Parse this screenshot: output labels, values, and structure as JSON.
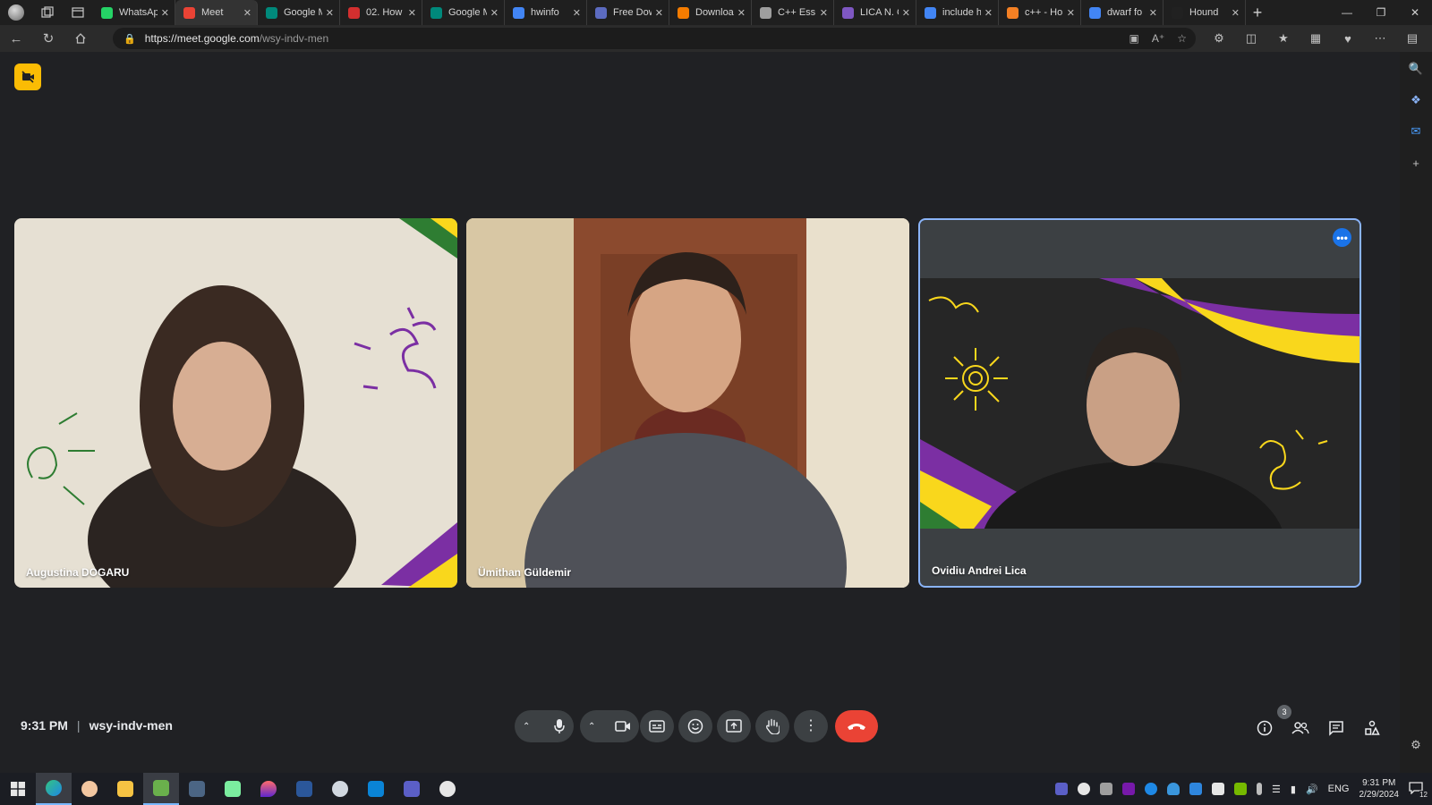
{
  "browser": {
    "tabs": [
      {
        "title": "WhatsApp",
        "favicon_color": "#25d366",
        "active": false
      },
      {
        "title": "Meet",
        "favicon_color": "#ea4335",
        "active": true
      },
      {
        "title": "Google Meet",
        "favicon_color": "#00897b",
        "active": false
      },
      {
        "title": "02. How",
        "favicon_color": "#d32f2f",
        "active": false
      },
      {
        "title": "Google Meet",
        "favicon_color": "#00897b",
        "active": false
      },
      {
        "title": "hwinfo",
        "favicon_color": "#4285f4",
        "active": false
      },
      {
        "title": "Free Dow",
        "favicon_color": "#5c6bc0",
        "active": false
      },
      {
        "title": "Downloa",
        "favicon_color": "#f57c00",
        "active": false
      },
      {
        "title": "C++ Ess",
        "favicon_color": "#9e9e9e",
        "active": false
      },
      {
        "title": "LICA N. C",
        "favicon_color": "#7e57c2",
        "active": false
      },
      {
        "title": "include h",
        "favicon_color": "#4285f4",
        "active": false
      },
      {
        "title": "c++ - Ho",
        "favicon_color": "#f48024",
        "active": false
      },
      {
        "title": "dwarf fo",
        "favicon_color": "#4285f4",
        "active": false
      },
      {
        "title": "Hound",
        "favicon_color": "#212121",
        "active": false
      }
    ],
    "url_host": "https://meet.google.com",
    "url_path": "/wsy-indv-men"
  },
  "meet": {
    "participants": [
      {
        "name": "Augustina DOGARU"
      },
      {
        "name": "Ümithan Güldemir"
      },
      {
        "name": "Ovidiu Andrei Lica"
      }
    ],
    "time": "9:31 PM",
    "separator": "|",
    "meeting_code": "wsy-indv-men",
    "people_count": "3",
    "more_options_glyph": "•••"
  },
  "taskbar": {
    "language": "ENG",
    "clock_time": "9:31 PM",
    "clock_date": "2/29/2024",
    "notification_count": "12"
  },
  "colors": {
    "meet_background": "#202124",
    "control_grey": "#3c4043",
    "end_call_red": "#ea4335",
    "active_speaker_blue": "#8ab4f8",
    "recording_yellow": "#fbbc04"
  }
}
